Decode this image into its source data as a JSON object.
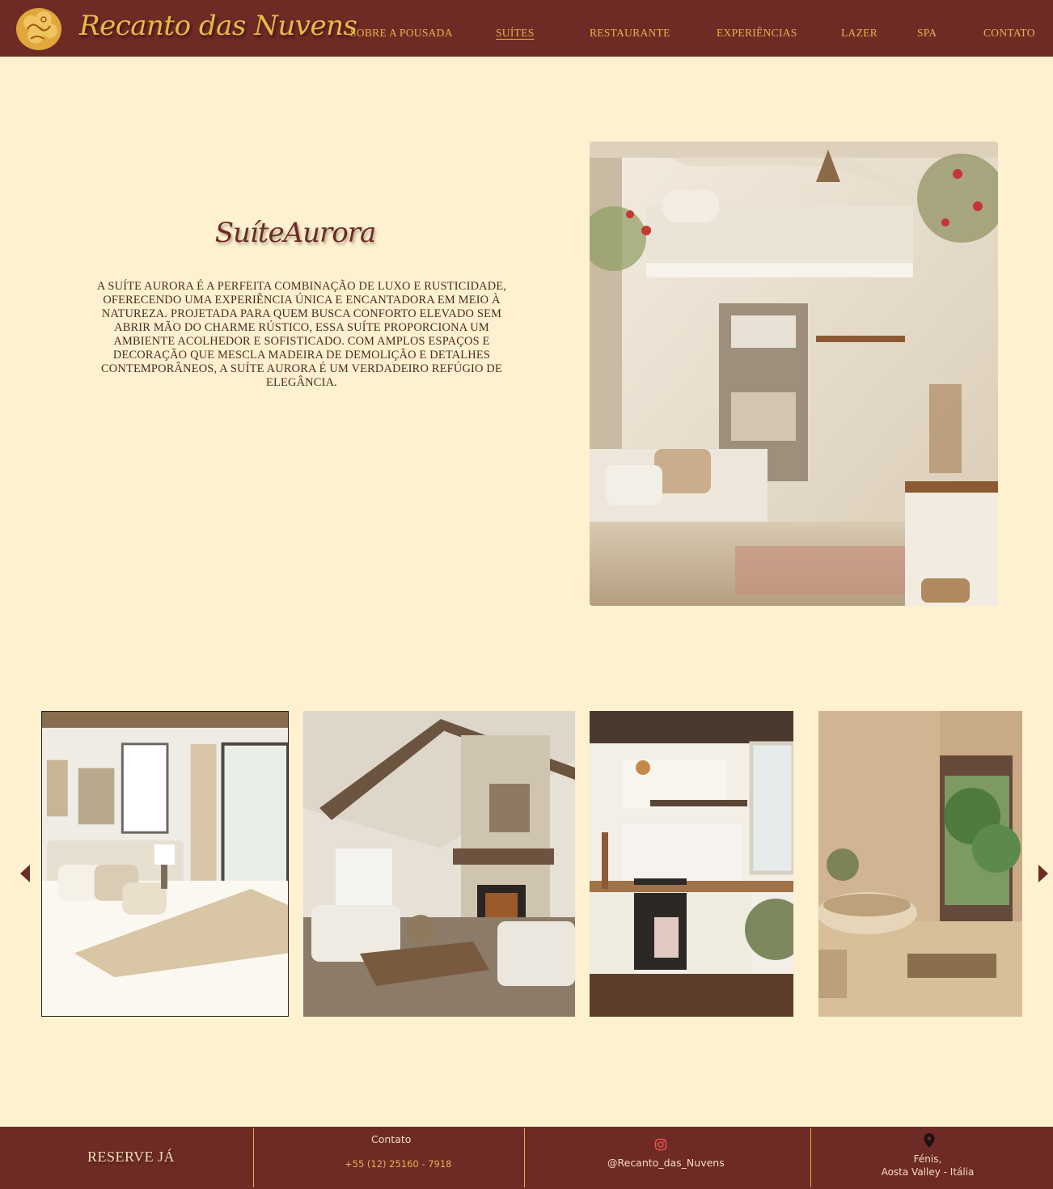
{
  "brand": {
    "name": "Recanto das Nuvens",
    "logo_icon": "cloud-emblem-icon"
  },
  "nav": {
    "items": [
      {
        "label": "SOBRE A POUSADA",
        "active": false
      },
      {
        "label": "SUÍTES",
        "active": true
      },
      {
        "label": "RESTAURANTE",
        "active": false
      },
      {
        "label": "EXPERIÊNCIAS",
        "active": false
      },
      {
        "label": "LAZER",
        "active": false
      },
      {
        "label": "SPA",
        "active": false
      },
      {
        "label": "CONTATO",
        "active": false
      }
    ]
  },
  "suite": {
    "title": "SuíteAurora",
    "description": "A Suíte Aurora é a perfeita combinação de luxo e rusticidade, oferecendo uma experiência única e encantadora em meio à natureza. Projetada para quem busca conforto elevado sem abrir mão do charme rústico, essa suíte proporciona um ambiente acolhedor e sofisticado. Com amplos espaços e decoração que mescla madeira de demolição e detalhes contemporâneos, a Suíte Aurora é um verdadeiro refúgio de elegância."
  },
  "gallery": {
    "prev_icon": "caret-left-icon",
    "next_icon": "caret-right-icon",
    "images": [
      "bedroom",
      "living-room",
      "kitchen",
      "bathroom"
    ]
  },
  "footer": {
    "reserve_label": "RESERVE JÁ",
    "contact_title": "Contato",
    "phone": "+55 (12) 25160 - 7918",
    "instagram_icon": "instagram-icon",
    "instagram_handle": "@Recanto_das_Nuvens",
    "location_icon": "map-pin-icon",
    "location_line1": "Fénis,",
    "location_line2": "Aosta Valley -  Itália"
  },
  "colors": {
    "header_bg": "#6e2a25",
    "page_bg": "#fef1cf",
    "accent_gold": "#e8b14f",
    "title_text": "#6e2a25"
  }
}
